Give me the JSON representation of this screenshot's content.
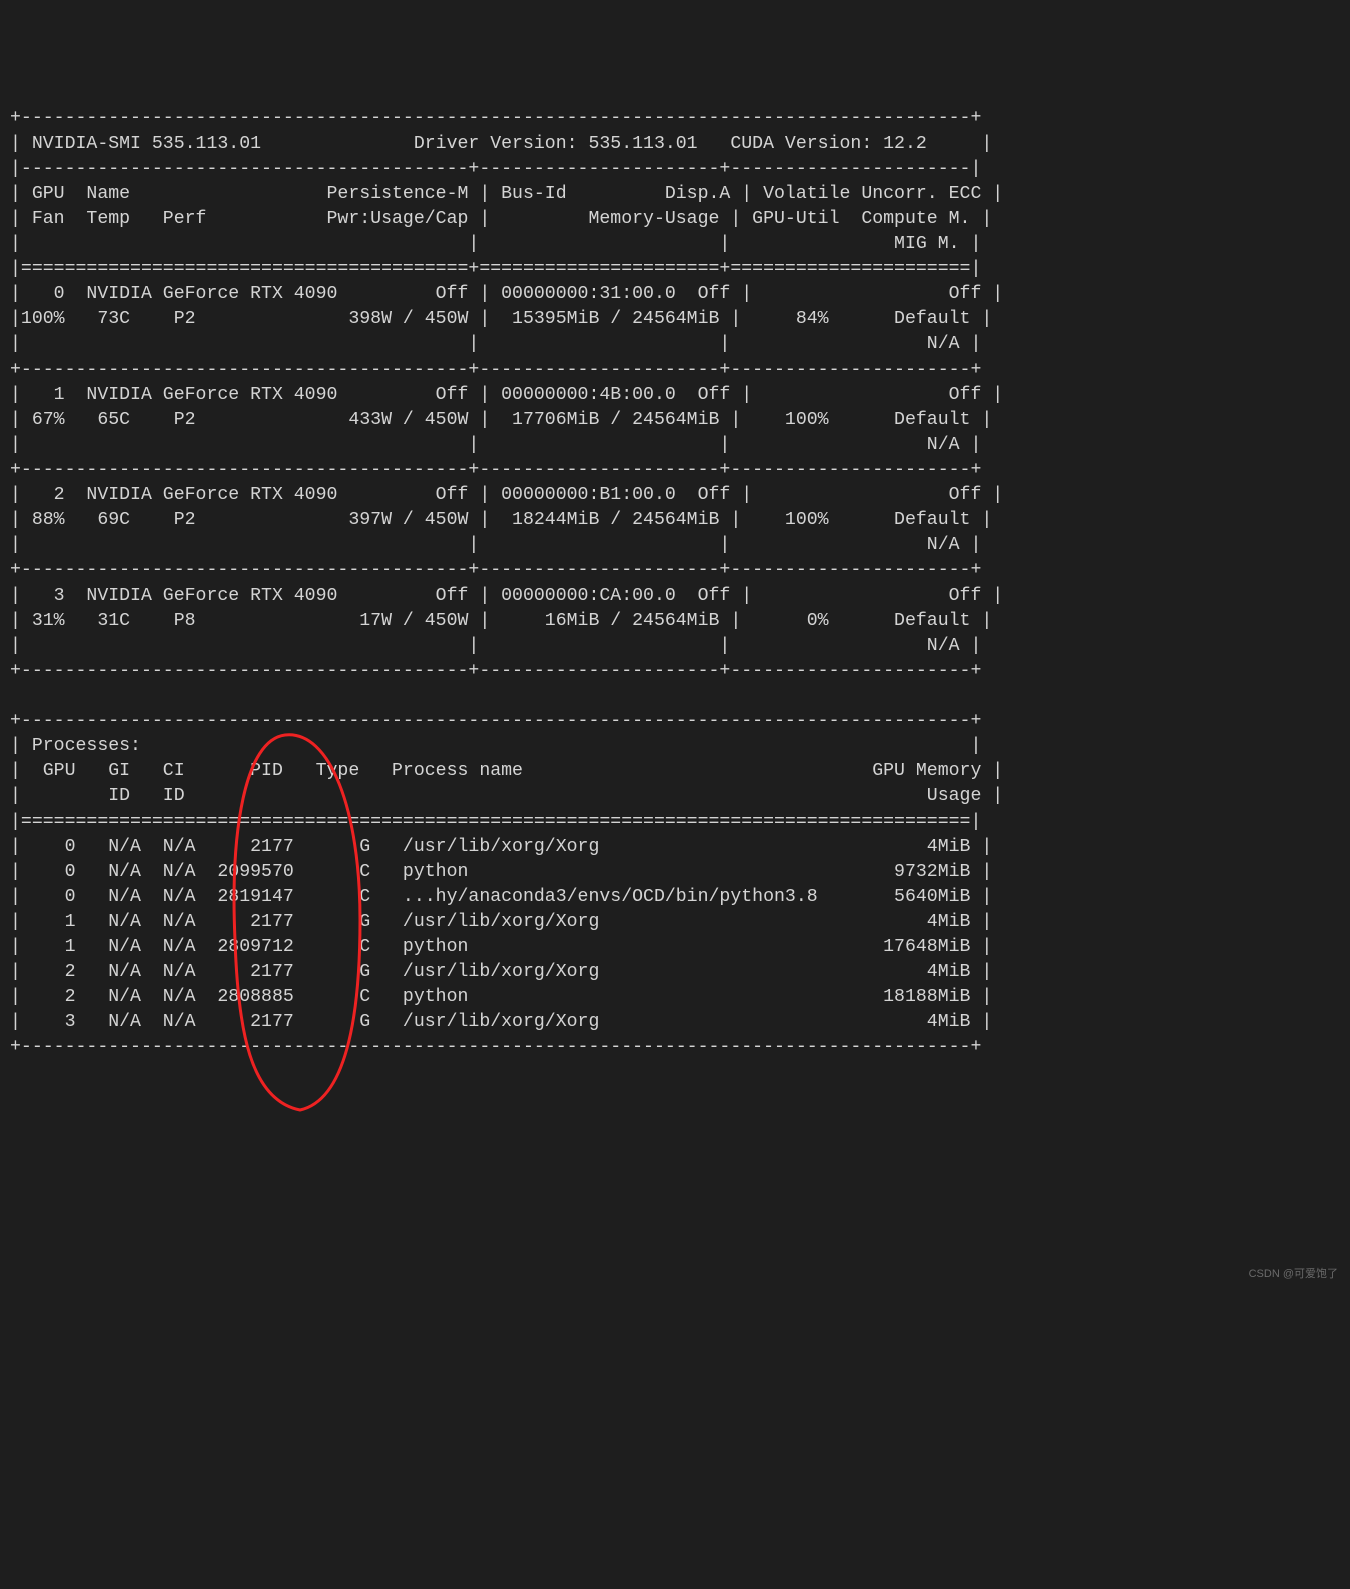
{
  "header": {
    "smi": "NVIDIA-SMI 535.113.01",
    "drv_label": "Driver Version:",
    "drv": "535.113.01",
    "cuda_label": "CUDA Version:",
    "cuda": "12.2"
  },
  "colhead": {
    "l1a": "GPU  Name",
    "l1b": "Persistence-M",
    "l1c": "Bus-Id",
    "l1d": "Disp.A",
    "l1e": "Volatile Uncorr. ECC",
    "l2a": "Fan  Temp   Perf",
    "l2b": "Pwr:Usage/Cap",
    "l2c": "Memory-Usage",
    "l2d": "GPU-Util",
    "l2e": "Compute M.",
    "l3e": "MIG M."
  },
  "gpus": [
    {
      "idx": "0",
      "name": "NVIDIA GeForce RTX 4090",
      "pm": "Off",
      "bus": "00000000:31:00.0",
      "disp": "Off",
      "ecc": "Off",
      "fan": "100%",
      "temp": "73C",
      "perf": "P2",
      "pwr": "398W / 450W",
      "mem": "15395MiB / 24564MiB",
      "util": "84%",
      "cm": "Default",
      "mig": "N/A"
    },
    {
      "idx": "1",
      "name": "NVIDIA GeForce RTX 4090",
      "pm": "Off",
      "bus": "00000000:4B:00.0",
      "disp": "Off",
      "ecc": "Off",
      "fan": "67%",
      "temp": "65C",
      "perf": "P2",
      "pwr": "433W / 450W",
      "mem": "17706MiB / 24564MiB",
      "util": "100%",
      "cm": "Default",
      "mig": "N/A"
    },
    {
      "idx": "2",
      "name": "NVIDIA GeForce RTX 4090",
      "pm": "Off",
      "bus": "00000000:B1:00.0",
      "disp": "Off",
      "ecc": "Off",
      "fan": "88%",
      "temp": "69C",
      "perf": "P2",
      "pwr": "397W / 450W",
      "mem": "18244MiB / 24564MiB",
      "util": "100%",
      "cm": "Default",
      "mig": "N/A"
    },
    {
      "idx": "3",
      "name": "NVIDIA GeForce RTX 4090",
      "pm": "Off",
      "bus": "00000000:CA:00.0",
      "disp": "Off",
      "ecc": "Off",
      "fan": "31%",
      "temp": "31C",
      "perf": "P8",
      "pwr": "17W / 450W",
      "mem": "16MiB / 24564MiB",
      "util": "0%",
      "cm": "Default",
      "mig": "N/A"
    }
  ],
  "proc_head": {
    "title": "Processes:",
    "l1": [
      "GPU",
      "GI",
      "CI",
      "PID",
      "Type",
      "Process name",
      "GPU Memory"
    ],
    "l2": [
      "",
      "ID",
      "ID",
      "",
      "",
      "",
      "Usage"
    ]
  },
  "procs": [
    {
      "gpu": "0",
      "gi": "N/A",
      "ci": "N/A",
      "pid": "2177",
      "type": "G",
      "name": "/usr/lib/xorg/Xorg",
      "mem": "4MiB"
    },
    {
      "gpu": "0",
      "gi": "N/A",
      "ci": "N/A",
      "pid": "2099570",
      "type": "C",
      "name": "python",
      "mem": "9732MiB"
    },
    {
      "gpu": "0",
      "gi": "N/A",
      "ci": "N/A",
      "pid": "2819147",
      "type": "C",
      "name": "...hy/anaconda3/envs/OCD/bin/python3.8",
      "mem": "5640MiB"
    },
    {
      "gpu": "1",
      "gi": "N/A",
      "ci": "N/A",
      "pid": "2177",
      "type": "G",
      "name": "/usr/lib/xorg/Xorg",
      "mem": "4MiB"
    },
    {
      "gpu": "1",
      "gi": "N/A",
      "ci": "N/A",
      "pid": "2809712",
      "type": "C",
      "name": "python",
      "mem": "17648MiB"
    },
    {
      "gpu": "2",
      "gi": "N/A",
      "ci": "N/A",
      "pid": "2177",
      "type": "G",
      "name": "/usr/lib/xorg/Xorg",
      "mem": "4MiB"
    },
    {
      "gpu": "2",
      "gi": "N/A",
      "ci": "N/A",
      "pid": "2808885",
      "type": "C",
      "name": "python",
      "mem": "18188MiB"
    },
    {
      "gpu": "3",
      "gi": "N/A",
      "ci": "N/A",
      "pid": "2177",
      "type": "G",
      "name": "/usr/lib/xorg/Xorg",
      "mem": "4MiB"
    }
  ],
  "watermark": "CSDN @可爱饱了"
}
